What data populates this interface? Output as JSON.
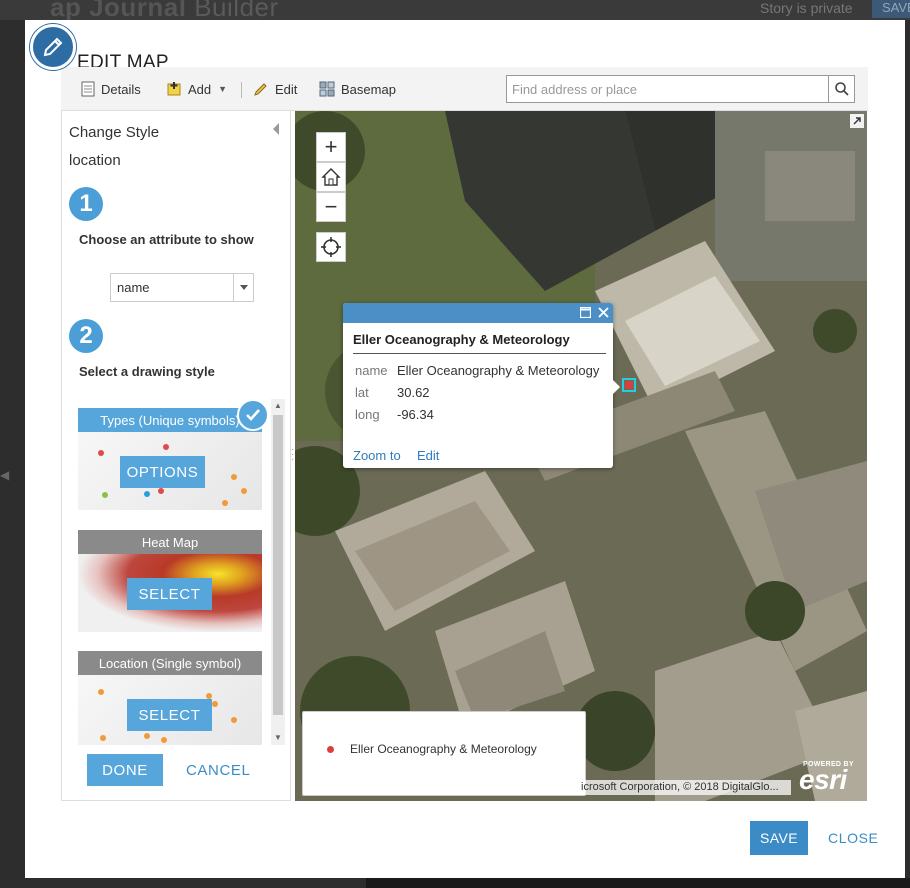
{
  "app": {
    "title_bold": "ap Journal",
    "title_light": "Builder",
    "privacy_status": "Story is private",
    "save_label": "SAVE"
  },
  "dialog": {
    "title": "EDIT MAP",
    "save_label": "SAVE",
    "close_label": "CLOSE"
  },
  "toolbar": {
    "details_label": "Details",
    "add_label": "Add",
    "edit_label": "Edit",
    "basemap_label": "Basemap",
    "search_placeholder": "Find address or place"
  },
  "panel": {
    "title": "Change Style",
    "layer_name": "location",
    "step1_number": "1",
    "step1_label": "Choose an attribute to show",
    "attribute_value": "name",
    "step2_number": "2",
    "step2_label": "Select a drawing style",
    "styles": [
      {
        "title": "Types (Unique symbols)",
        "button": "OPTIONS",
        "selected": true,
        "header_color": "#56a6dc"
      },
      {
        "title": "Heat Map",
        "button": "SELECT",
        "selected": false,
        "header_color": "#8a8a8a"
      },
      {
        "title": "Location (Single symbol)",
        "button": "SELECT",
        "selected": false,
        "header_color": "#8a8a8a"
      }
    ],
    "done_label": "DONE",
    "cancel_label": "CANCEL"
  },
  "map": {
    "zoom_in": "+",
    "zoom_out": "−",
    "popup": {
      "title": "Eller Oceanography & Meteorology",
      "fields": [
        {
          "key": "name",
          "value": "Eller Oceanography & Meteorology"
        },
        {
          "key": "lat",
          "value": "30.62"
        },
        {
          "key": "long",
          "value": "-96.34"
        }
      ],
      "zoom_to_label": "Zoom to",
      "edit_label": "Edit"
    },
    "legend": {
      "label": "Eller Oceanography & Meteorology",
      "color": "#d84040"
    },
    "attribution": "icrosoft Corporation, © 2018 DigitalGlo...",
    "logo_powered": "POWERED BY",
    "logo_name": "esri"
  },
  "colors": {
    "accent": "#56a6dc",
    "primary_button": "#3b8cc6",
    "popup_header": "#4c8fc6",
    "marker": "#d84040"
  }
}
